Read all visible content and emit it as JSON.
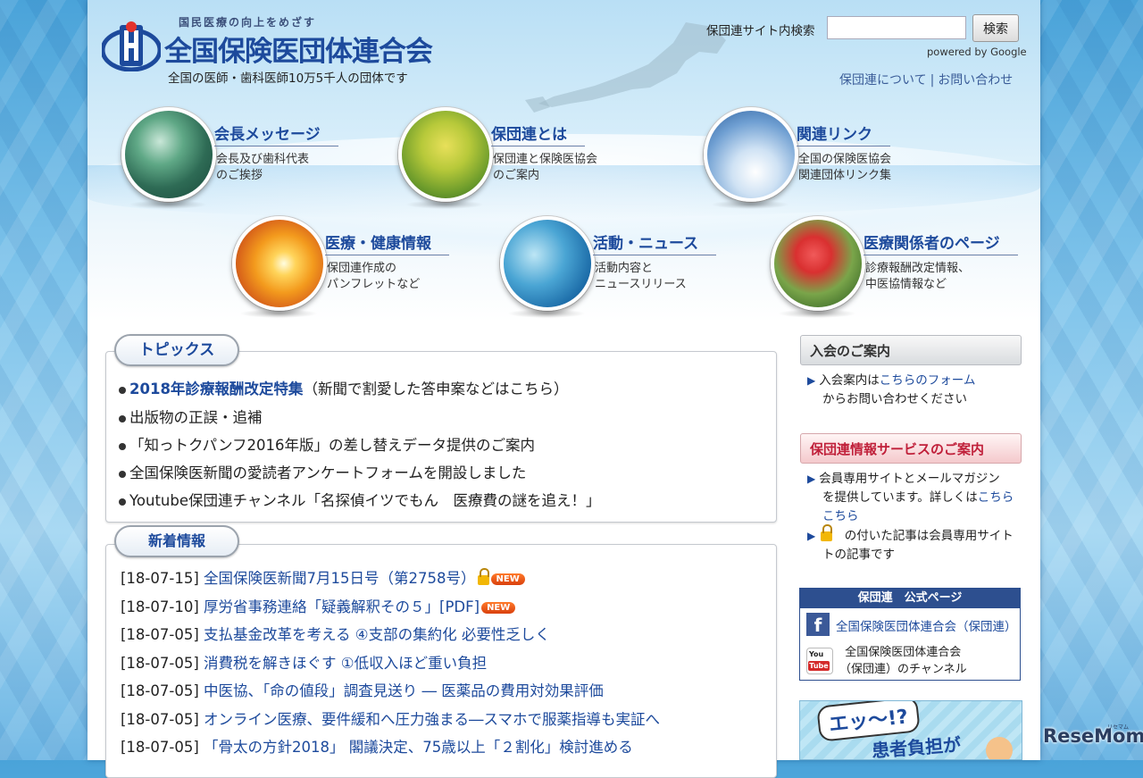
{
  "header": {
    "tagline": "国民医療の向上をめざす",
    "org_name": "全国保険医団体連合会",
    "org_sub": "全国の医師・歯科医師10万5千人の団体です",
    "search_label": "保団連サイト内検索",
    "search_value": "",
    "search_button": "検索",
    "powered_by": "powered by Google",
    "links": [
      "保団連について",
      "お問い合わせ"
    ]
  },
  "features": [
    {
      "title": "会長メッセージ",
      "desc": "会長及び歯科代表\nのご挨拶"
    },
    {
      "title": "保団連とは",
      "desc": "保団連と保険医協会\nのご案内"
    },
    {
      "title": "関連リンク",
      "desc": "全国の保険医協会\n関連団体リンク集"
    },
    {
      "title": "医療・健康情報",
      "desc": "保団連作成の\nパンフレットなど"
    },
    {
      "title": "活動・ニュース",
      "desc": "活動内容と\nニュースリリース"
    },
    {
      "title": "医療関係者のページ",
      "desc": "診療報酬改定情報、\n中医協情報など"
    }
  ],
  "topics": {
    "heading": "トピックス",
    "items": [
      {
        "bold": "2018年診療報酬改定特集",
        "text": "（新聞で割愛した答申案などはこちら）"
      },
      {
        "bold": "",
        "text": "出版物の正誤・追補"
      },
      {
        "bold": "",
        "text": "「知っトクパンフ2016年版」の差し替えデータ提供のご案内"
      },
      {
        "bold": "",
        "text": "全国保険医新聞の愛読者アンケートフォームを開設しました"
      },
      {
        "bold": "",
        "text": "Youtube保団連チャンネル「名探偵イツでもん　医療費の謎を追え！」"
      }
    ]
  },
  "news": {
    "heading": "新着情報",
    "new_label": "NEW",
    "items": [
      {
        "date": "[18-07-15]",
        "title": "全国保険医新聞7月15日号（第2758号）",
        "lock": true,
        "new": true
      },
      {
        "date": "[18-07-10]",
        "title": "厚労省事務連絡「疑義解釈その５」[PDF]",
        "lock": false,
        "new": true
      },
      {
        "date": "[18-07-05]",
        "title": "支払基金改革を考える ④支部の集約化 必要性乏しく",
        "lock": false,
        "new": false
      },
      {
        "date": "[18-07-05]",
        "title": "消費税を解きほぐす ①低収入ほど重い負担",
        "lock": false,
        "new": false
      },
      {
        "date": "[18-07-05]",
        "title": "中医協、「命の値段」調査見送り ― 医薬品の費用対効果評価",
        "lock": false,
        "new": false
      },
      {
        "date": "[18-07-05]",
        "title": "オンライン医療、要件緩和へ圧力強まる―スマホで服薬指導も実証へ",
        "lock": false,
        "new": false
      },
      {
        "date": "[18-07-05]",
        "title": "「骨太の方針2018」 閣議決定、75歳以上「２割化」検討進める",
        "lock": false,
        "new": false
      }
    ]
  },
  "sidebar": {
    "join_heading": "入会のご案内",
    "join_text_pre": "入会案内は",
    "join_link": "こちらのフォーム",
    "join_text_post": "からお問い合わせください",
    "service_heading": "保団連情報サービスのご案内",
    "service_text_1": "会員専用サイトとメールマガジン",
    "service_text_2": "を提供しています。詳しくは",
    "service_link": "こちら",
    "service_lock_text_1": "の付いた記事は会員専用サイト",
    "service_lock_text_2": "トの記事です",
    "sns_heading": "保団連　公式ページ",
    "facebook_icon_letter": "f",
    "facebook_label": "全国保険医団体連合会（保団連）",
    "youtube_icon_top": "You",
    "youtube_icon_bottom": "Tube",
    "youtube_label": "全国保険医団体連合会\n（保団連）のチャンネル",
    "banner_line1": "エッ～!?",
    "banner_line2": "患者負担が"
  },
  "watermark": "ReseMom",
  "watermark_small": "リセマム",
  "colors": {
    "brand_blue": "#1d4a9c",
    "new_orange": "#d9400c",
    "service_red": "#c0203a"
  }
}
